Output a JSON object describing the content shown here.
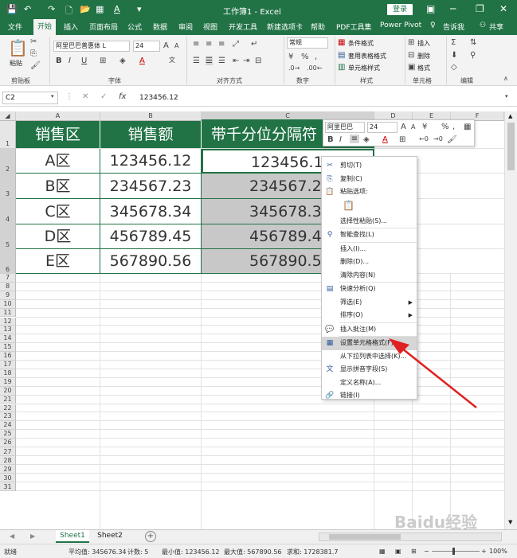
{
  "window": {
    "title": "工作簿1 - Excel",
    "login": "登录",
    "min": "─",
    "restore": "❐",
    "close": "✕"
  },
  "quick": {
    "save": "💾",
    "undo": "↶",
    "redo": "↷",
    "new": "🗋",
    "open": "📂",
    "chart": "▦",
    "font_color": "A",
    "more": "▾"
  },
  "tabs": [
    "文件",
    "开始",
    "插入",
    "页面布局",
    "公式",
    "数据",
    "审阅",
    "视图",
    "开发工具",
    "新建选项卡",
    "帮助",
    "PDF工具集",
    "Power Pivot",
    "告诉我",
    "共享"
  ],
  "ribbon": {
    "clipboard": {
      "label": "剪贴板",
      "paste": "粘贴"
    },
    "font": {
      "label": "字体",
      "name": "阿里巴巴普惠体 L",
      "size": "24",
      "bold": "B",
      "italic": "I",
      "underline": "U",
      "grow": "A",
      "shrink": "A",
      "wen": "文"
    },
    "align": {
      "label": "对齐方式"
    },
    "number": {
      "label": "数字",
      "format": "常规",
      "percent": "%",
      "comma": ","
    },
    "styles": {
      "label": "样式",
      "cond": "条件格式",
      "table": "套用表格格式",
      "cell": "单元格样式"
    },
    "cells": {
      "label": "单元格",
      "insert": "插入",
      "delete": "删除",
      "format": "格式"
    },
    "edit": {
      "label": "编辑"
    }
  },
  "formula_bar": {
    "name_box": "C2",
    "cancel": "✕",
    "confirm": "✓",
    "fx": "fx",
    "value": "123456.12"
  },
  "columns": [
    "A",
    "B",
    "C",
    "D",
    "E",
    "F"
  ],
  "rows": [
    "1",
    "2",
    "3",
    "4",
    "5",
    "6",
    "7",
    "8",
    "9",
    "10",
    "11",
    "12",
    "13",
    "14",
    "15",
    "16",
    "17",
    "18",
    "19",
    "20",
    "21",
    "22",
    "23",
    "24",
    "25",
    "26",
    "27",
    "28",
    "29",
    "30",
    "31"
  ],
  "table": {
    "headers": [
      "销售区",
      "销售额",
      "带千分位分隔符"
    ],
    "data": [
      [
        "A区",
        "123456.12",
        "123456.12"
      ],
      [
        "B区",
        "234567.23",
        "234567.23"
      ],
      [
        "C区",
        "345678.34",
        "345678.34"
      ],
      [
        "D区",
        "456789.45",
        "456789.45"
      ],
      [
        "E区",
        "567890.56",
        "567890.56"
      ]
    ]
  },
  "mini_toolbar": {
    "font": "阿里巴巴",
    "size": "24",
    "bold": "B",
    "italic": "I",
    "percent": "%",
    "comma": ","
  },
  "context_menu": [
    {
      "label": "剪切(T)",
      "icon": "✂"
    },
    {
      "label": "复制(C)",
      "icon": "⎘"
    },
    {
      "label": "粘贴选项:",
      "icon": "📋"
    },
    {
      "label": "",
      "icon": "📋"
    },
    {
      "label": "选择性粘贴(S)...",
      "icon": ""
    },
    {
      "label": "智能查找(L)",
      "icon": "⚲"
    },
    {
      "label": "插入(I)...",
      "icon": ""
    },
    {
      "label": "删除(D)...",
      "icon": ""
    },
    {
      "label": "清除内容(N)",
      "icon": ""
    },
    {
      "label": "快速分析(Q)",
      "icon": "▤"
    },
    {
      "label": "筛选(E)",
      "icon": "",
      "arrow": "▶"
    },
    {
      "label": "排序(O)",
      "icon": "",
      "arrow": "▶"
    },
    {
      "label": "插入批注(M)",
      "icon": "💬"
    },
    {
      "label": "设置单元格格式(F)...",
      "icon": "▦"
    },
    {
      "label": "从下拉列表中选择(K)...",
      "icon": ""
    },
    {
      "label": "显示拼音字段(S)",
      "icon": "文"
    },
    {
      "label": "定义名称(A)...",
      "icon": ""
    },
    {
      "label": "链接(I)",
      "icon": "🔗"
    }
  ],
  "sheets": [
    "Sheet1",
    "Sheet2"
  ],
  "add_sheet": "+",
  "status": {
    "ready": "就绪",
    "avg": "平均值: 345676.34",
    "count": "计数: 5",
    "min": "最小值: 123456.12",
    "max": "最大值: 567890.56",
    "sum": "求和: 1728381.7",
    "zoom": "100%"
  },
  "watermark": "Baidu经验"
}
